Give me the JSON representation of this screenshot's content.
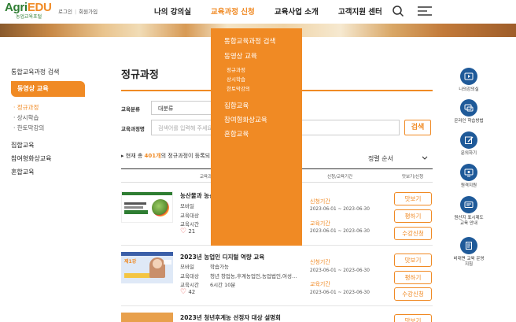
{
  "header": {
    "logo_main": "Agri",
    "logo_accent": "EDU",
    "logo_sub": "농업교육포털",
    "login": "로그인",
    "divider": "|",
    "join": "회원가입",
    "nav": [
      "나의 강의실",
      "교육과정 신청",
      "교육사업 소개",
      "고객지원 센터"
    ],
    "active_nav": "교육과정 신청"
  },
  "dropdown": {
    "items": [
      "통합교육과정 검색",
      "동영상 교육",
      "집합교육",
      "참여형화상교육",
      "혼합교육"
    ],
    "sub_items": [
      "정규과정",
      "상시학습",
      "한토막강의"
    ]
  },
  "sidebar": {
    "title": "통합교육과정 검색",
    "active": "동영상 교육",
    "sub_items": [
      "정규과정",
      "상시학습",
      "한토막강의"
    ],
    "items": [
      "집합교육",
      "참여형화상교육",
      "혼합교육"
    ]
  },
  "main": {
    "page_title": "정규과정",
    "filter": {
      "category_label": "교육분류",
      "category_value": "대분류",
      "name_label": "교육과정명",
      "name_placeholder": "검색어를 입력해 주세요",
      "search_button": "검색"
    },
    "total_prefix": "현재 총",
    "total_count": "401개",
    "total_suffix": "의 정규과정이 등록되",
    "sort": "정렬 순서",
    "columns": [
      "교육과",
      "신청/교육기간",
      "맛보기/신청"
    ],
    "courses": [
      {
        "title": "농산물과 농산",
        "meta": [
          [
            "모바일",
            ""
          ],
          [
            "교육대상",
            ""
          ],
          [
            "교육시간",
            ""
          ]
        ],
        "likes": "21",
        "apply_label": "신청기간",
        "apply_date": "2023-06-01 ~ 2023-06-30",
        "edu_label": "교육기간",
        "edu_date": "2023-06-01 ~ 2023-06-30",
        "buttons": [
          "맛보기",
          "평하기",
          "수강신청"
        ],
        "thumb_text": "농산물과 농산"
      },
      {
        "title": "2023년 농업인 디지털 역량 교육",
        "meta": [
          [
            "모바일",
            "학습가능"
          ],
          [
            "교육대상",
            "청년 창업농,후계농업인,농업법인,여성…"
          ],
          [
            "교육시간",
            "6시간 10분"
          ]
        ],
        "likes": "42",
        "apply_label": "신청기간",
        "apply_date": "2023-06-01 ~ 2023-06-30",
        "edu_label": "교육기간",
        "edu_date": "2023-06-01 ~ 2023-06-30",
        "buttons": [
          "맛보기",
          "평하기",
          "수강신청"
        ],
        "thumb_text": "제1강"
      },
      {
        "title": "2023년 청년후계농 선정자 대상 설명회",
        "buttons": [
          "맛보기"
        ]
      }
    ]
  },
  "quick_menu": [
    {
      "icon": "play-icon",
      "label": "나의강의실"
    },
    {
      "icon": "chat-icon",
      "label": "온라인 학습방법"
    },
    {
      "icon": "edit-icon",
      "label": "문의하기"
    },
    {
      "icon": "monitor-icon",
      "label": "원격지원"
    },
    {
      "icon": "card-icon",
      "label": "원산지 표시제도 교육 안내"
    },
    {
      "icon": "document-icon",
      "label": "비대면 교육 운영 지침"
    }
  ],
  "colors": {
    "accent": "#f08a24",
    "brand_green": "#2e7d32",
    "quick_blue": "#1f5a99"
  }
}
